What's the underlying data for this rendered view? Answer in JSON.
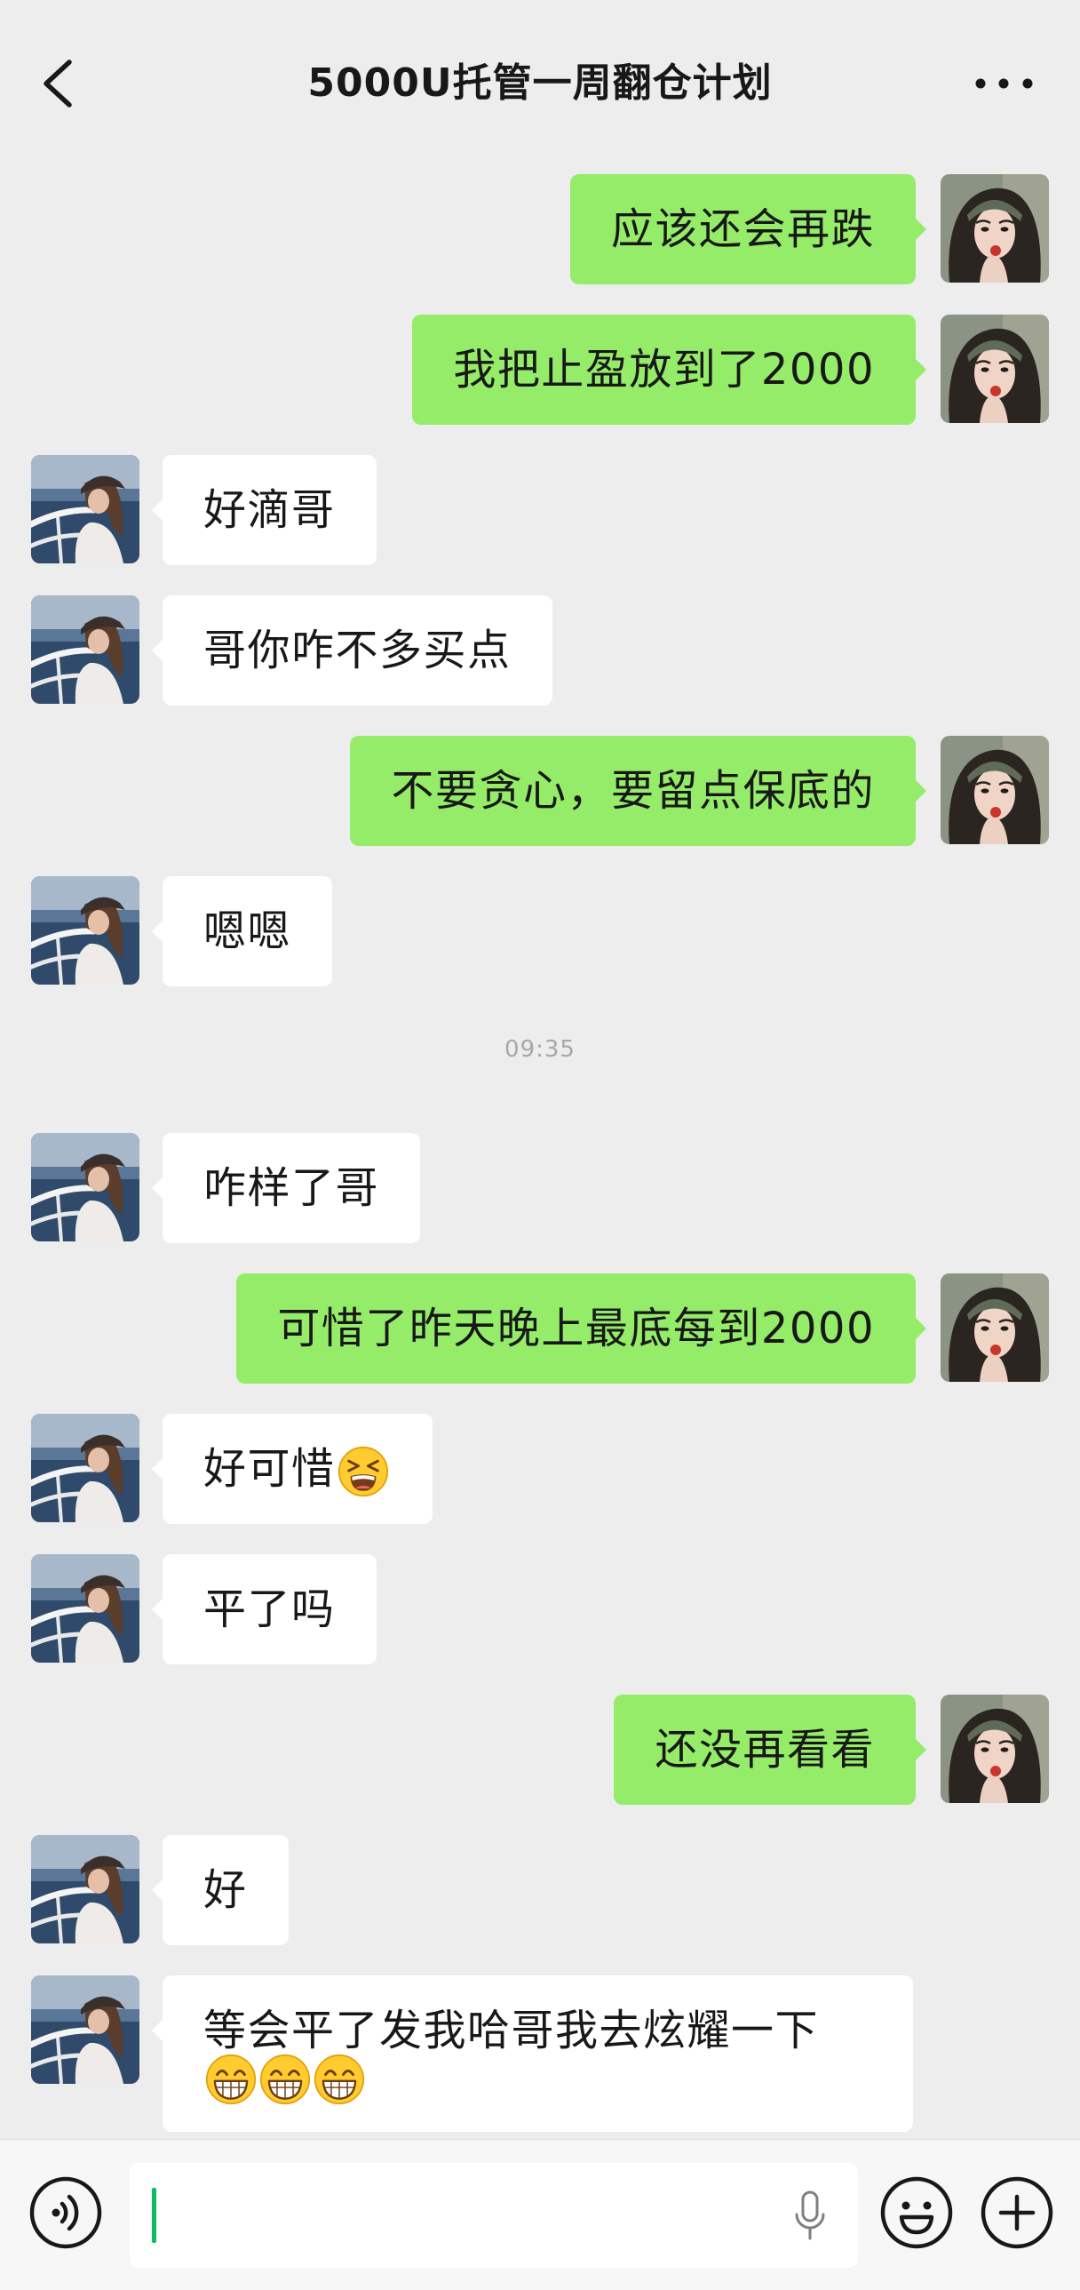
{
  "header": {
    "title": "5000U托管一周翻仓计划",
    "back_icon": "chevron-left-icon",
    "more_icon": "more-dots-icon"
  },
  "colors": {
    "background": "#EDEDED",
    "sent_bubble": "#95EC69",
    "received_bubble": "#FFFFFF",
    "text": "#181818",
    "timestamp": "#A8A8A8",
    "input_bar": "#F7F7F7",
    "cursor": "#07C160"
  },
  "messages": [
    {
      "outgoing": true,
      "text": "应该还会再跌"
    },
    {
      "outgoing": true,
      "text": "我把止盈放到了2000"
    },
    {
      "outgoing": false,
      "text": "好滴哥"
    },
    {
      "outgoing": false,
      "text": "哥你咋不多买点"
    },
    {
      "outgoing": true,
      "text": "不要贪心，要留点保底的"
    },
    {
      "outgoing": false,
      "text": "嗯嗯"
    },
    {
      "timestamp": "09:35"
    },
    {
      "outgoing": false,
      "text": "咋样了哥"
    },
    {
      "outgoing": true,
      "text": "可惜了昨天晚上最底每到2000"
    },
    {
      "outgoing": false,
      "text": "好可惜",
      "emojis": [
        "tired-face-icon"
      ]
    },
    {
      "outgoing": false,
      "text": "平了吗"
    },
    {
      "outgoing": true,
      "text": "还没再看看"
    },
    {
      "outgoing": false,
      "text": "好"
    },
    {
      "outgoing": false,
      "text": "等会平了发我哈哥我去炫耀一下",
      "emojis": [
        "grinning-face-icon",
        "grinning-face-icon",
        "grinning-face-icon"
      ]
    }
  ],
  "input_bar": {
    "message_input_value": "",
    "voice_icon": "voice-icon",
    "mic_icon": "microphone-icon",
    "emoji_icon": "emoji-icon",
    "plus_icon": "plus-icon"
  }
}
